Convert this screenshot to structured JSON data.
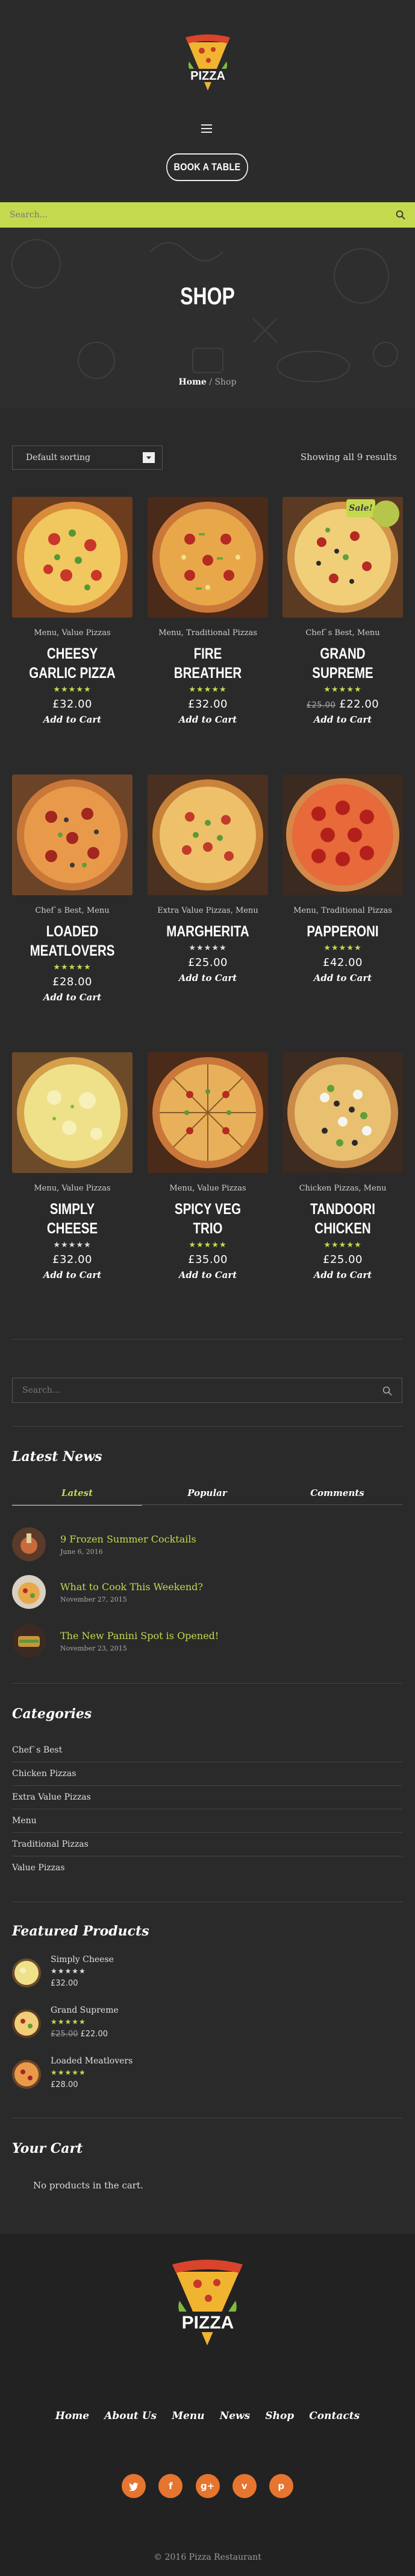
{
  "header": {
    "logo_text": "PIZZA",
    "book_button": "BOOK A TABLE"
  },
  "search": {
    "placeholder": "Search..."
  },
  "banner": {
    "title": "SHOP",
    "crumb_home": "Home",
    "crumb_sep": " / ",
    "crumb_current": "Shop"
  },
  "shop": {
    "sort_selected": "Default sorting",
    "result_count": "Showing all 9 results",
    "products": [
      {
        "cats": "Menu, Value Pizzas",
        "name": "CHEESY GARLIC PIZZA",
        "stars": "★★★★★",
        "star_color": "#c5d94f",
        "price": "£32.00",
        "old_price": "",
        "cart": "Add to Cart"
      },
      {
        "cats": "Menu, Traditional Pizzas",
        "name": "FIRE BREATHER",
        "stars": "★★★★★",
        "star_color": "#c5d94f",
        "price": "£32.00",
        "old_price": "",
        "cart": "Add to Cart"
      },
      {
        "cats": "Chef`s Best, Menu",
        "name": "GRAND SUPREME",
        "stars": "★★★★★",
        "star_color": "#c5d94f",
        "price": "£22.00",
        "old_price": "£25.00",
        "cart": "Add to Cart",
        "sale": "Sale!"
      },
      {
        "cats": "Chef`s Best, Menu",
        "name": "LOADED MEATLOVERS",
        "stars": "★★★★★",
        "star_color": "#c5d94f",
        "price": "£28.00",
        "old_price": "",
        "cart": "Add to Cart"
      },
      {
        "cats": "Extra Value Pizzas, Menu",
        "name": "MARGHERITA",
        "stars": "★★★★★",
        "star_color": "#dddddd",
        "price": "£25.00",
        "old_price": "",
        "cart": "Add to Cart"
      },
      {
        "cats": "Menu, Traditional Pizzas",
        "name": "PAPPERONI",
        "stars": "★★★★★",
        "star_color": "#c5d94f",
        "price": "£42.00",
        "old_price": "",
        "cart": "Add to Cart"
      },
      {
        "cats": "Menu, Value Pizzas",
        "name": "SIMPLY CHEESE",
        "stars": "★★★★★",
        "star_color": "#dddddd",
        "price": "£32.00",
        "old_price": "",
        "cart": "Add to Cart"
      },
      {
        "cats": "Menu, Value Pizzas",
        "name": "SPICY VEG TRIO",
        "stars": "★★★★★",
        "star_color": "#c5d94f",
        "price": "£35.00",
        "old_price": "",
        "cart": "Add to Cart"
      },
      {
        "cats": "Chicken Pizzas, Menu",
        "name": "TANDOORI CHICKEN",
        "stars": "★★★★★",
        "star_color": "#c5d94f",
        "price": "£25.00",
        "old_price": "",
        "cart": "Add to Cart"
      }
    ]
  },
  "sidebar": {
    "search_placeholder": "Search...",
    "latest_news_title": "Latest News",
    "tabs": [
      "Latest",
      "Popular",
      "Comments"
    ],
    "news": [
      {
        "title": "9 Frozen Summer Cocktails",
        "date": "June 6, 2016"
      },
      {
        "title": "What to Cook This Weekend?",
        "date": "November 27, 2015"
      },
      {
        "title": "The New Panini Spot is Opened!",
        "date": "November 23, 2015"
      }
    ],
    "categories_title": "Categories",
    "categories": [
      "Chef`s Best",
      "Chicken Pizzas",
      "Extra Value Pizzas",
      "Menu",
      "Traditional Pizzas",
      "Value Pizzas"
    ],
    "featured_title": "Featured Products",
    "featured": [
      {
        "name": "Simply Cheese",
        "stars": "★★★★★",
        "price": "£32.00",
        "old_price": ""
      },
      {
        "name": "Grand Supreme",
        "stars": "★★★★★",
        "price": "£22.00",
        "old_price": "£25.00"
      },
      {
        "name": "Loaded Meatlovers",
        "stars": "★★★★★",
        "price": "£28.00",
        "old_price": ""
      }
    ],
    "cart_title": "Your Cart",
    "cart_empty": "No products in the cart."
  },
  "footer": {
    "logo_text": "PIZZA",
    "nav": [
      "Home",
      "About Us",
      "Menu",
      "News",
      "Shop",
      "Contacts"
    ],
    "social": [
      "twitter-icon",
      "facebook-icon",
      "google-plus-icon",
      "vimeo-icon",
      "pinterest-icon"
    ],
    "copyright": "© 2016 Pizza Restaurant"
  },
  "colors": {
    "accent": "#c5d94f",
    "social": "#e6752f",
    "background": "#2a2a2a"
  }
}
